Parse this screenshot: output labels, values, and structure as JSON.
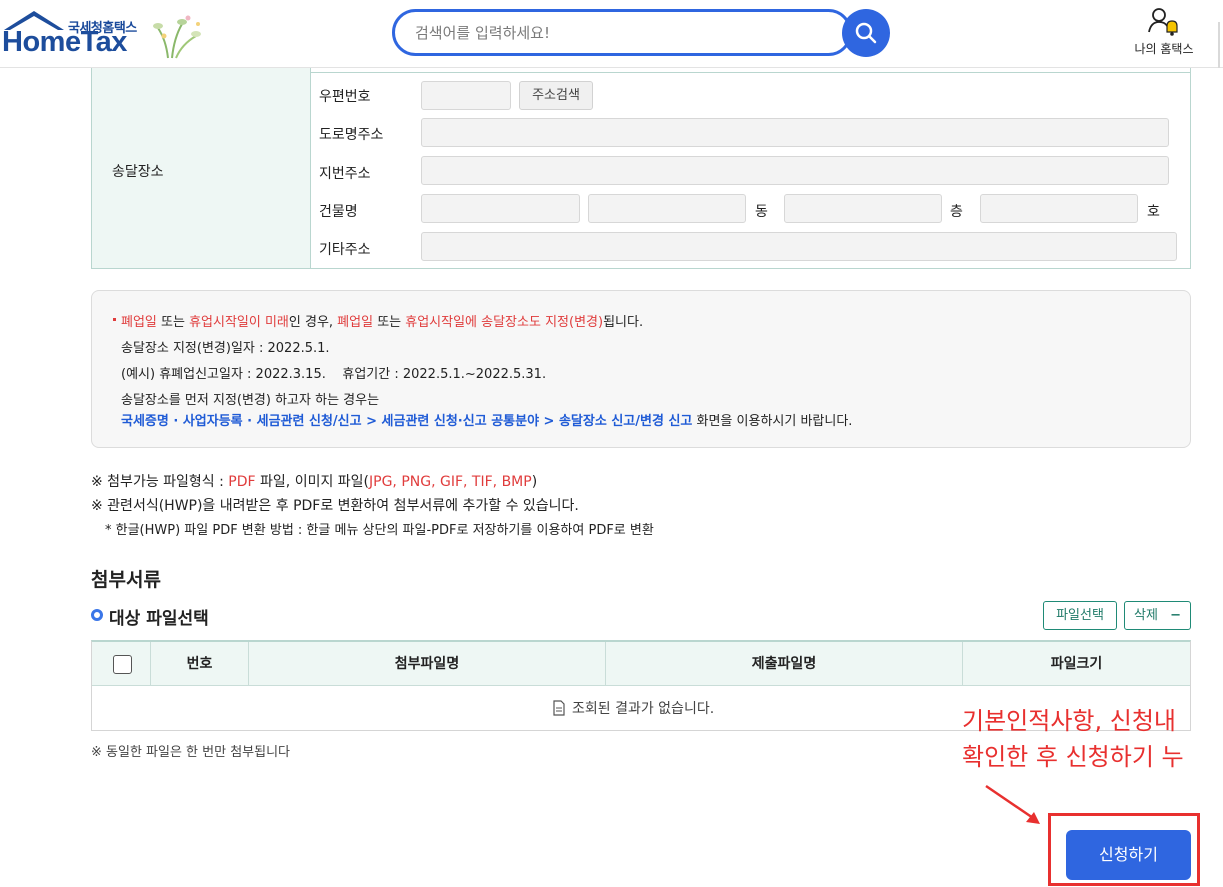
{
  "header": {
    "logo_small": "국세청홈택스",
    "logo_big": "HomeTax",
    "search_placeholder": "검색어를 입력하세요!",
    "my_hometax": "나의 홈택스"
  },
  "address": {
    "section_label": "송달장소",
    "postal_code_label": "우편번호",
    "address_search_button": "주소검색",
    "road_address_label": "도로명주소",
    "lot_address_label": "지번주소",
    "building_label": "건물명",
    "dong_unit": "동",
    "floor_unit": "층",
    "ho_unit": "호",
    "other_address_label": "기타주소"
  },
  "notice": {
    "line1": [
      {
        "t": "폐업일",
        "c": "red"
      },
      {
        "t": " 또는 ",
        "c": ""
      },
      {
        "t": "휴업시작일이 미래",
        "c": "red"
      },
      {
        "t": "인 경우, ",
        "c": ""
      },
      {
        "t": "폐업일",
        "c": "red"
      },
      {
        "t": " 또는 ",
        "c": ""
      },
      {
        "t": "휴업시작일에 송달장소도 지정(변경)",
        "c": "red"
      },
      {
        "t": "됩니다.",
        "c": ""
      }
    ],
    "line2": "송달장소 지정(변경)일자 : 2022.5.1.",
    "line3": "(예시) 휴폐업신고일자 : 2022.3.15.    휴업기간 : 2022.5.1.~2022.5.31.",
    "line4": "송달장소를 먼저 지정(변경) 하고자 하는 경우는",
    "line5_link": "국세증명 · 사업자등록 · 세금관련 신청/신고 > 세금관련 신청·신고 공통분야 > 송달장소 신고/변경 신고",
    "line5_rest": " 화면을 이용하시기 바랍니다."
  },
  "info": {
    "line1_prefix": "※ 첨부가능 파일형식 : ",
    "line1_pdf": "PDF",
    "line1_mid": " 파일, 이미지 파일(",
    "line1_imgs": "JPG, PNG, GIF, TIF, BMP",
    "line1_suffix": ")",
    "line2": "※ 관련서식(HWP)을 내려받은 후 PDF로 변환하여 첨부서류에 추가할 수 있습니다.",
    "line3": "* 한글(HWP) 파일 PDF 변환 방법 : 한글 메뉴 상단의 파일-PDF로 저장하기를 이용하여 PDF로 변환"
  },
  "attachments": {
    "title": "첨부서류",
    "subtitle": "대상 파일선택",
    "select_file_button": "파일선택",
    "delete_button": "삭제",
    "delete_symbol": "−",
    "columns": [
      "번호",
      "첨부파일명",
      "제출파일명",
      "파일크기"
    ],
    "empty_message": "조회된 결과가 없습니다.",
    "footnote": "※ 동일한 파일은 한 번만 첨부됩니다"
  },
  "annotation": {
    "line1": "기본인적사항, 신청내",
    "line2": "확인한 후 신청하기 누",
    "color": "#e8302f"
  },
  "apply_button": "신청하기",
  "colors": {
    "primary": "#2f66e0",
    "table_header_bg": "#eef7f4",
    "accent_red": "#e03c3c"
  }
}
